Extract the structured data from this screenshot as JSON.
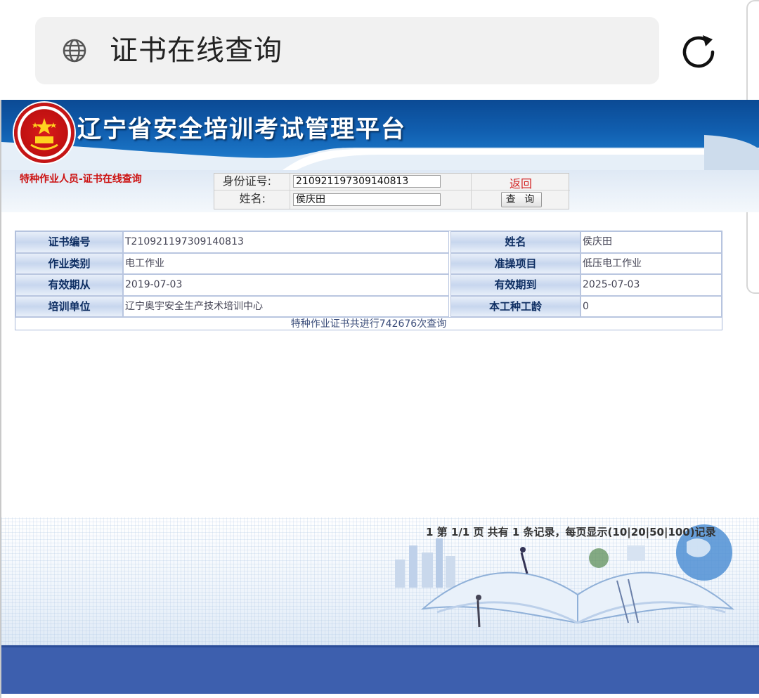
{
  "browser": {
    "url_text": "证书在线查询",
    "globe_icon": "globe-icon",
    "reload_icon": "reload-icon"
  },
  "banner": {
    "title": "辽宁省安全培训考试管理平台",
    "emblem": "state-emblem"
  },
  "search": {
    "module_title": "特种作业人员-证书在线查询",
    "id_label": "身份证号:",
    "id_value": "210921197309140813",
    "name_label": "姓名:",
    "name_value": "侯庆田",
    "back_label": "返回",
    "query_label": "查 询"
  },
  "result": {
    "rows": [
      {
        "h1": "证书编号",
        "v1": "T210921197309140813",
        "h2": "姓名",
        "v2": "侯庆田"
      },
      {
        "h1": "作业类别",
        "v1": "电工作业",
        "h2": "准操项目",
        "v2": "低压电工作业"
      },
      {
        "h1": "有效期从",
        "v1": "2019-07-03",
        "h2": "有效期到",
        "v2": "2025-07-03"
      },
      {
        "h1": "培训单位",
        "v1": "辽宁奥宇安全生产技术培训中心",
        "h2": "本工种工龄",
        "v2": "0"
      }
    ],
    "footer": "特种作业证书共进行742676次查询"
  },
  "pager": {
    "text": "1   第 1/1 页 共有 1 条记录，每页显示(10|20|50|100)记录"
  },
  "colors": {
    "banner": "#115fb0",
    "accent_red": "#cc1111",
    "footer_bar": "#3d5fae"
  }
}
